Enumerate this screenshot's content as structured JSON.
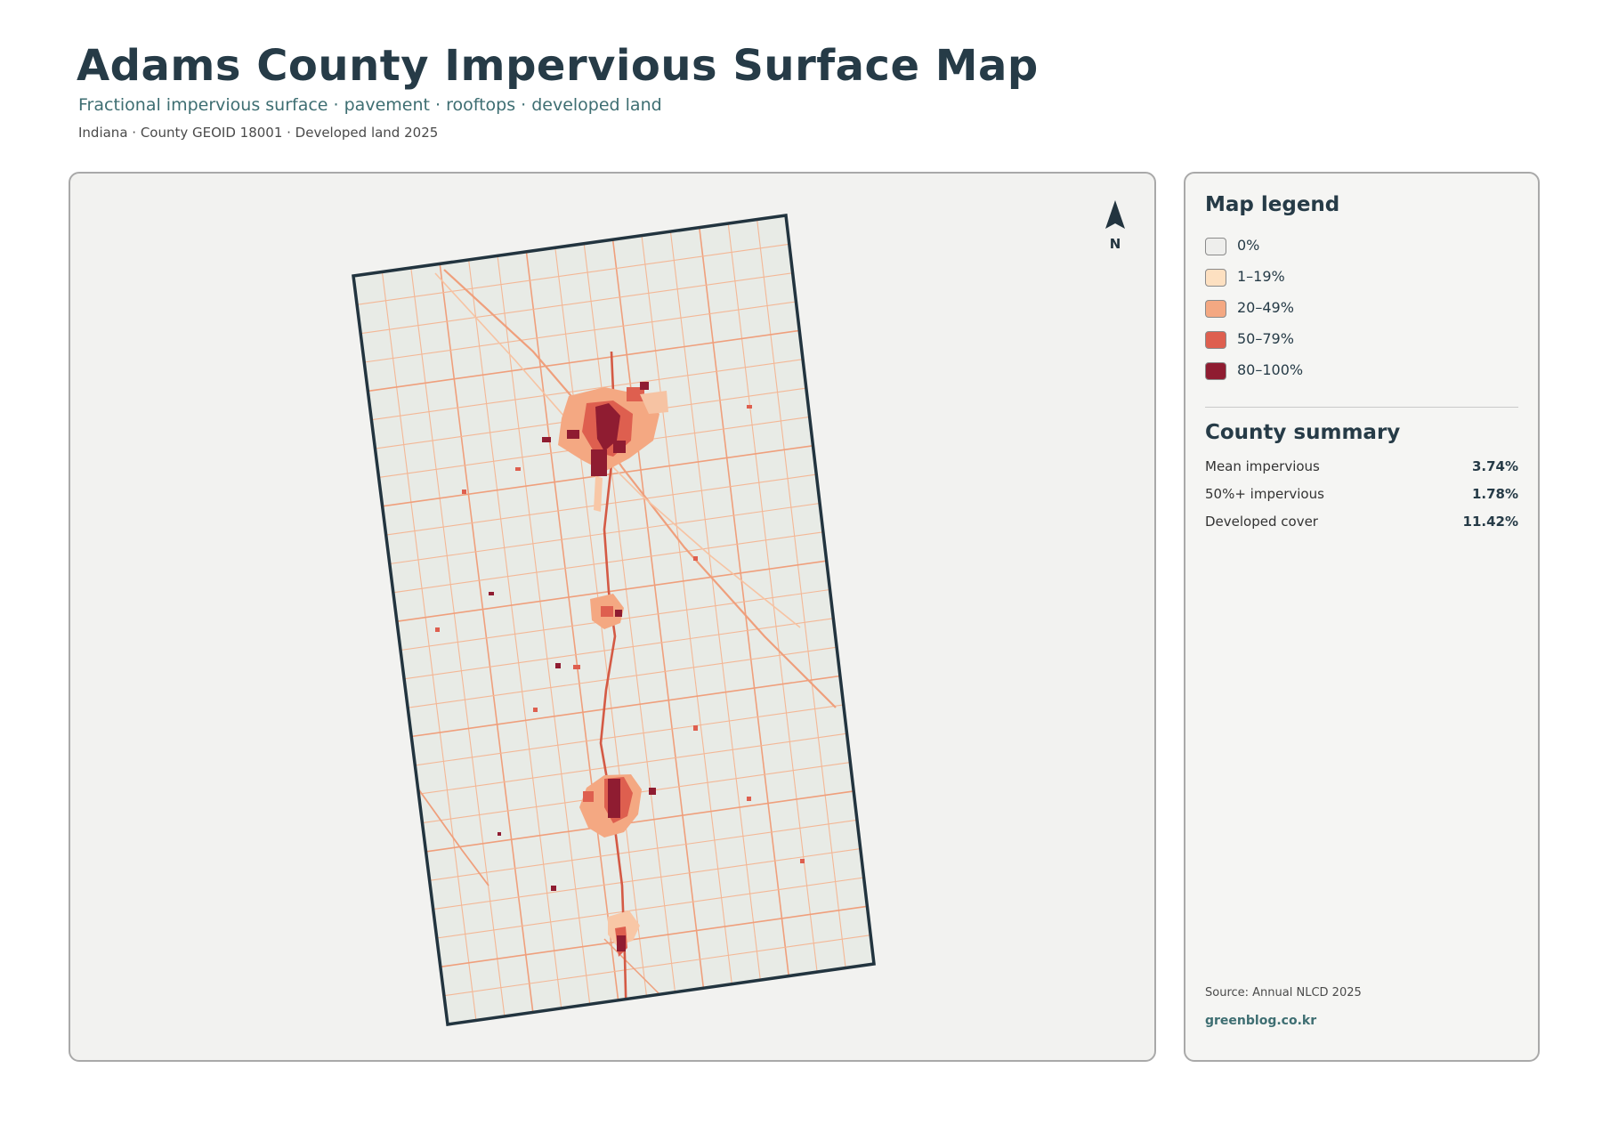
{
  "header": {
    "title": "Adams County Impervious Surface Map",
    "subtitle": "Fractional impervious surface · pavement · rooftops · developed land",
    "meta": "Indiana · County GEOID 18001 · Developed land 2025"
  },
  "map": {
    "north_label": "N",
    "colors": {
      "boundary": "#22343f",
      "land": "#e8ebe6",
      "panel_background": "#f2f2f0"
    }
  },
  "legend": {
    "title": "Map legend",
    "items": [
      {
        "label": "0%",
        "color": "#eeeeec"
      },
      {
        "label": "1–19%",
        "color": "#fde0c1"
      },
      {
        "label": "20–49%",
        "color": "#f4a882"
      },
      {
        "label": "50–79%",
        "color": "#de5f4f"
      },
      {
        "label": "80–100%",
        "color": "#8f1c31"
      }
    ]
  },
  "summary": {
    "title": "County summary",
    "stats": [
      {
        "label": "Mean impervious",
        "value": "3.74%"
      },
      {
        "label": "50%+ impervious",
        "value": "1.78%"
      },
      {
        "label": "Developed cover",
        "value": "11.42%"
      }
    ]
  },
  "footer": {
    "source": "Source: Annual NLCD 2025",
    "credit": "greenblog.co.kr"
  }
}
